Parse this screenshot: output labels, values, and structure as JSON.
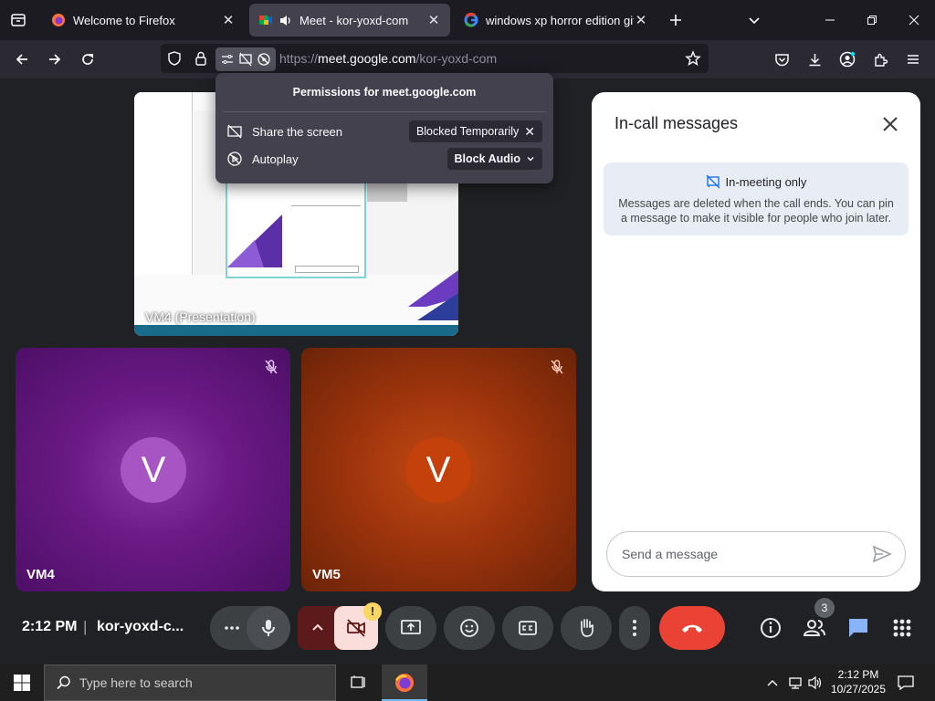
{
  "tabs": [
    {
      "title": "Welcome to Firefox"
    },
    {
      "title": "Meet - kor-yoxd-com"
    },
    {
      "title": "windows xp horror edition git h"
    }
  ],
  "url": {
    "scheme": "https://",
    "host": "meet.google.com",
    "path": "/kor-yoxd-com"
  },
  "permissions": {
    "title": "Permissions for meet.google.com",
    "rows": [
      {
        "label": "Share the screen",
        "value": "Blocked Temporarily"
      },
      {
        "label": "Autoplay",
        "value": "Block Audio"
      }
    ]
  },
  "presentation": {
    "label": "VM4 (Presentation)"
  },
  "participants": [
    {
      "initial": "V",
      "name": "VM4",
      "color": "#8e24aa"
    },
    {
      "initial": "V",
      "name": "VM5",
      "color": "#bf360c"
    }
  ],
  "chat": {
    "title": "In-call messages",
    "notice_title": "In-meeting only",
    "notice_body": "Messages are deleted when the call ends. You can pin a message to make it visible for people who join later.",
    "placeholder": "Send a message"
  },
  "bottom": {
    "time": "2:12 PM",
    "separator": "|",
    "meeting_code": "kor-yoxd-c...",
    "people_count": "3",
    "warning_badge": "!"
  },
  "taskbar": {
    "search_placeholder": "Type here to search",
    "time": "2:12 PM",
    "date": "10/27/2025"
  },
  "colors": {
    "end_call": "#ea4335",
    "chat_active": "#8ab4f8",
    "camera_off": "#f9dedc"
  }
}
